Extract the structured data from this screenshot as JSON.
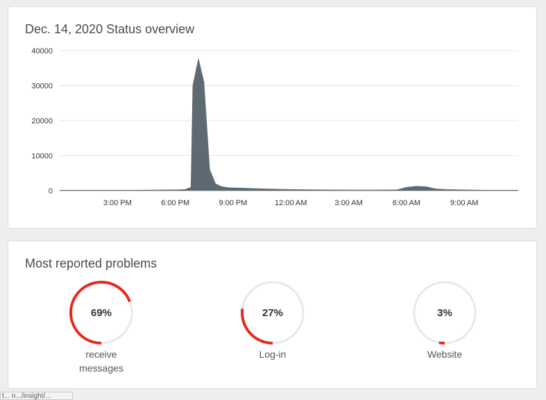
{
  "status_card": {
    "title": "Dec. 14, 2020 Status overview"
  },
  "chart_data": {
    "type": "area",
    "title": "Dec. 14, 2020 Status overview",
    "xlabel": "",
    "ylabel": "",
    "ylim": [
      0,
      40000
    ],
    "yticks": [
      0,
      10000,
      20000,
      30000,
      40000
    ],
    "xticks": [
      "3:00 PM",
      "6:00 PM",
      "9:00 PM",
      "12:00 AM",
      "3:00 AM",
      "6:00 AM",
      "9:00 AM"
    ],
    "xtick_hours": [
      15,
      18,
      21,
      24,
      27,
      30,
      33
    ],
    "xlim_hours": [
      12.0,
      35.8
    ],
    "grid": true,
    "color": "#5e6a71",
    "x_hours": [
      12.0,
      14.0,
      16.0,
      18.0,
      18.5,
      18.8,
      18.9,
      19.2,
      19.5,
      19.8,
      20.1,
      20.4,
      20.8,
      21.5,
      22.5,
      24.0,
      25.5,
      27.0,
      28.5,
      29.5,
      30.0,
      30.5,
      31.0,
      31.5,
      32.0,
      33.0,
      34.0,
      35.8
    ],
    "values": [
      200,
      200,
      200,
      300,
      400,
      1000,
      30000,
      38000,
      31000,
      6000,
      2000,
      1200,
      900,
      800,
      600,
      400,
      300,
      250,
      250,
      300,
      1000,
      1300,
      1200,
      600,
      400,
      300,
      200,
      200
    ]
  },
  "problems_card": {
    "title": "Most reported problems",
    "items": [
      {
        "percent_label": "69%",
        "fraction": 0.69,
        "label_lines": [
          "receive",
          "messages"
        ]
      },
      {
        "percent_label": "27%",
        "fraction": 0.27,
        "label_lines": [
          "Log-in"
        ]
      },
      {
        "percent_label": "3%",
        "fraction": 0.03,
        "label_lines": [
          "Website"
        ]
      }
    ],
    "track_color": "#e4eaec",
    "arc_color": "#e8281e"
  },
  "status_bar": {
    "text": "t... n.../insight/..."
  }
}
